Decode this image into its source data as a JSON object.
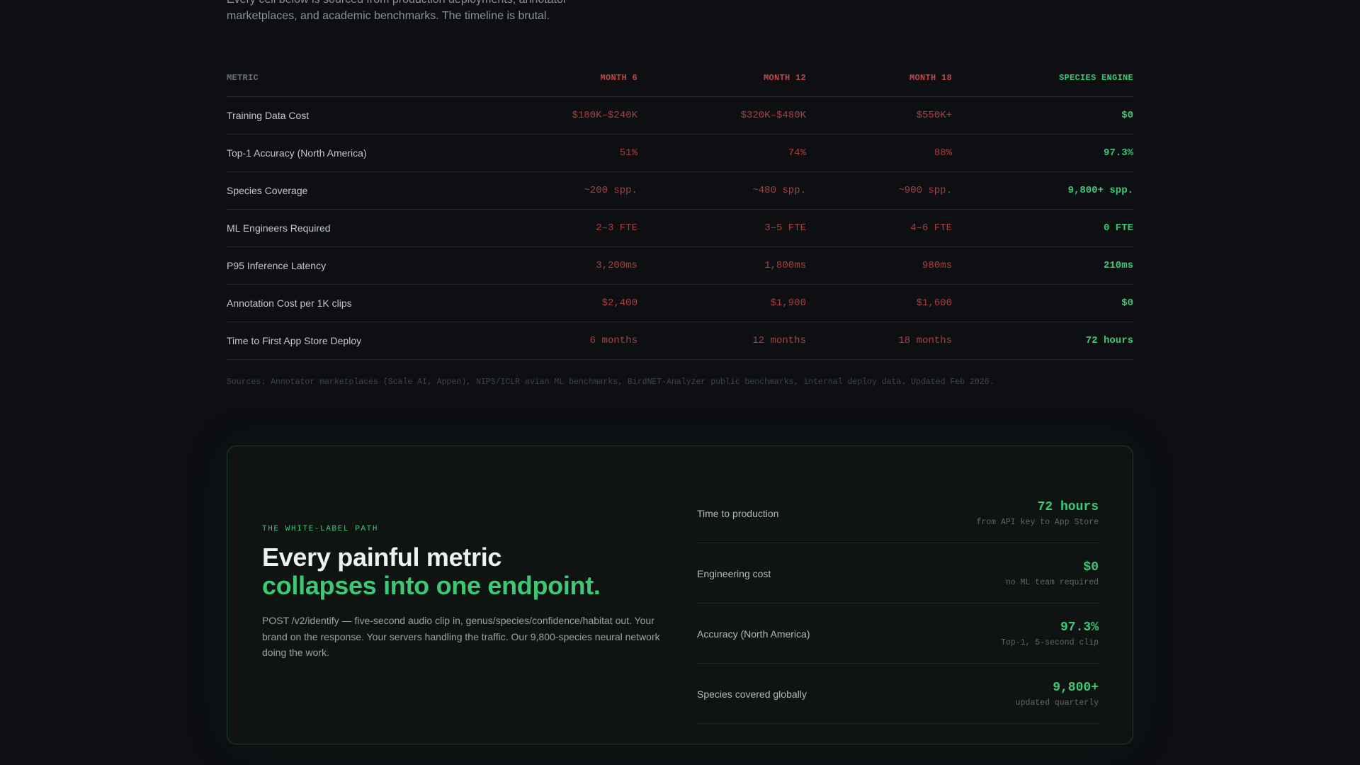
{
  "intro": {
    "line1": "Every cell below is sourced from production deployments, annotator",
    "line2": "marketplaces, and academic benchmarks. The timeline is brutal."
  },
  "table": {
    "headers": [
      "METRIC",
      "MONTH 6",
      "MONTH 12",
      "MONTH 18",
      "SPECIES ENGINE"
    ],
    "rows": [
      {
        "metric": "Training Data Cost",
        "m6": "$180K–$240K",
        "m12": "$320K–$480K",
        "m18": "$550K+",
        "engine": "$0"
      },
      {
        "metric": "Top-1 Accuracy (North America)",
        "m6": "51%",
        "m12": "74%",
        "m18": "88%",
        "engine": "97.3%"
      },
      {
        "metric": "Species Coverage",
        "m6": "~200 spp.",
        "m12": "~480 spp.",
        "m18": "~900 spp.",
        "engine": "9,800+ spp."
      },
      {
        "metric": "ML Engineers Required",
        "m6": "2–3 FTE",
        "m12": "3–5 FTE",
        "m18": "4–6 FTE",
        "engine": "0 FTE"
      },
      {
        "metric": "P95 Inference Latency",
        "m6": "3,200ms",
        "m12": "1,800ms",
        "m18": "980ms",
        "engine": "210ms"
      },
      {
        "metric": "Annotation Cost per 1K clips",
        "m6": "$2,400",
        "m12": "$1,900",
        "m18": "$1,600",
        "engine": "$0"
      },
      {
        "metric": "Time to First App Store Deploy",
        "m6": "6 months",
        "m12": "12 months",
        "m18": "18 months",
        "engine": "72 hours"
      }
    ],
    "sources": "Sources: Annotator marketplaces (Scale AI, Appen), NIPS/ICLR avian ML benchmarks, BirdNET-Analyzer public benchmarks, internal deploy data. Updated Feb 2026."
  },
  "card": {
    "eyebrow": "THE WHITE-LABEL PATH",
    "headline_line1": "Every painful metric",
    "headline_line2": "collapses into one endpoint.",
    "description": "POST /v2/identify — five-second audio clip in, genus/species/confidence/habitat out. Your brand on the response. Your servers handling the traffic. Our 9,800-species neural network doing the work.",
    "stats": [
      {
        "label": "Time to production",
        "value": "72 hours",
        "sub": "from API key to App Store"
      },
      {
        "label": "Engineering cost",
        "value": "$0",
        "sub": "no ML team required"
      },
      {
        "label": "Accuracy (North America)",
        "value": "97.3%",
        "sub": "Top-1, 5-second clip"
      },
      {
        "label": "Species covered globally",
        "value": "9,800+",
        "sub": "updated quarterly"
      }
    ]
  },
  "colors": {
    "background": "#0d0f12",
    "accent_green": "#3ec775",
    "accent_red": "#c0474a",
    "card_border": "#1e3b2b"
  }
}
